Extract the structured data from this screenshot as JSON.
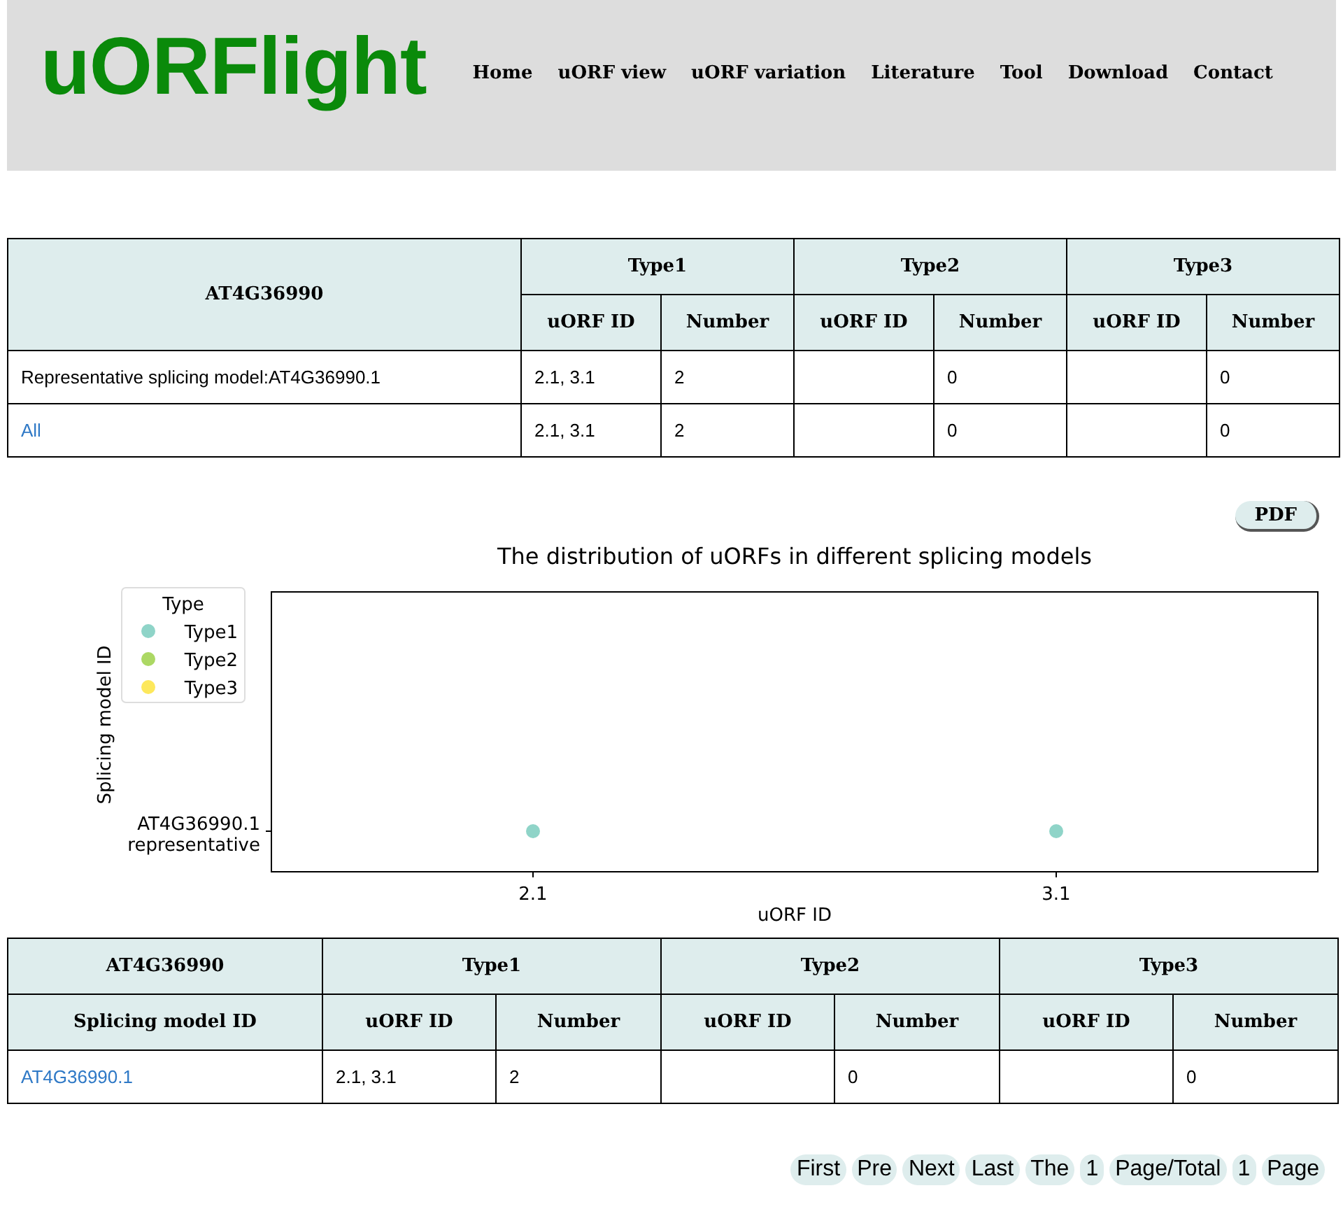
{
  "header": {
    "logo": "uORFlight",
    "nav": [
      "Home",
      "uORF view",
      "uORF variation",
      "Literature",
      "Tool",
      "Download",
      "Contact"
    ]
  },
  "summary_table": {
    "gene": "AT4G36990",
    "groups": [
      {
        "name": "Type1",
        "subcolumns": [
          "uORF ID",
          "Number"
        ]
      },
      {
        "name": "Type2",
        "subcolumns": [
          "uORF ID",
          "Number"
        ]
      },
      {
        "name": "Type3",
        "subcolumns": [
          "uORF ID",
          "Number"
        ]
      }
    ],
    "rows": [
      {
        "kind": "text",
        "label": "Representative splicing model:AT4G36990.1",
        "cells": [
          "2.1, 3.1",
          "2",
          null,
          "0",
          null,
          "0"
        ]
      },
      {
        "kind": "link",
        "label": "All",
        "cells": [
          "2.1, 3.1",
          "2",
          null,
          "0",
          null,
          "0"
        ]
      }
    ]
  },
  "pdf_button": "PDF",
  "plot": {
    "title": "The distribution of uORFs in different splicing models",
    "xlabel": "uORF ID",
    "ylabel": "Splicing model ID",
    "legend_title": "Type",
    "x_ticks": [
      {
        "label": "2.1",
        "color": "#8fd4c8"
      },
      {
        "label": "3.1",
        "color": "#8fd4c8"
      }
    ],
    "y_ticks": [
      "AT4G36990.1 representative"
    ],
    "legend": [
      {
        "name": "Type1",
        "color": "#8fd4c8"
      },
      {
        "name": "Type2",
        "color": "#acd864"
      },
      {
        "name": "Type3",
        "color": "#fde85c"
      }
    ]
  },
  "model_table": {
    "gene": "AT4G36990",
    "first_column": "Splicing model ID",
    "groups": [
      {
        "name": "Type1",
        "subcolumns": [
          "uORF ID",
          "Number"
        ]
      },
      {
        "name": "Type2",
        "subcolumns": [
          "uORF ID",
          "Number"
        ]
      },
      {
        "name": "Type3",
        "subcolumns": [
          "uORF ID",
          "Number"
        ]
      }
    ],
    "rows": [
      {
        "kind": "link",
        "label": "AT4G36990.1",
        "cells": [
          "2.1, 3.1",
          "2",
          null,
          "0",
          null,
          "0"
        ]
      }
    ]
  },
  "pagination": [
    "First",
    "Pre",
    "Next",
    "Last",
    "The",
    "1",
    "Page/Total",
    "1",
    "Page"
  ]
}
